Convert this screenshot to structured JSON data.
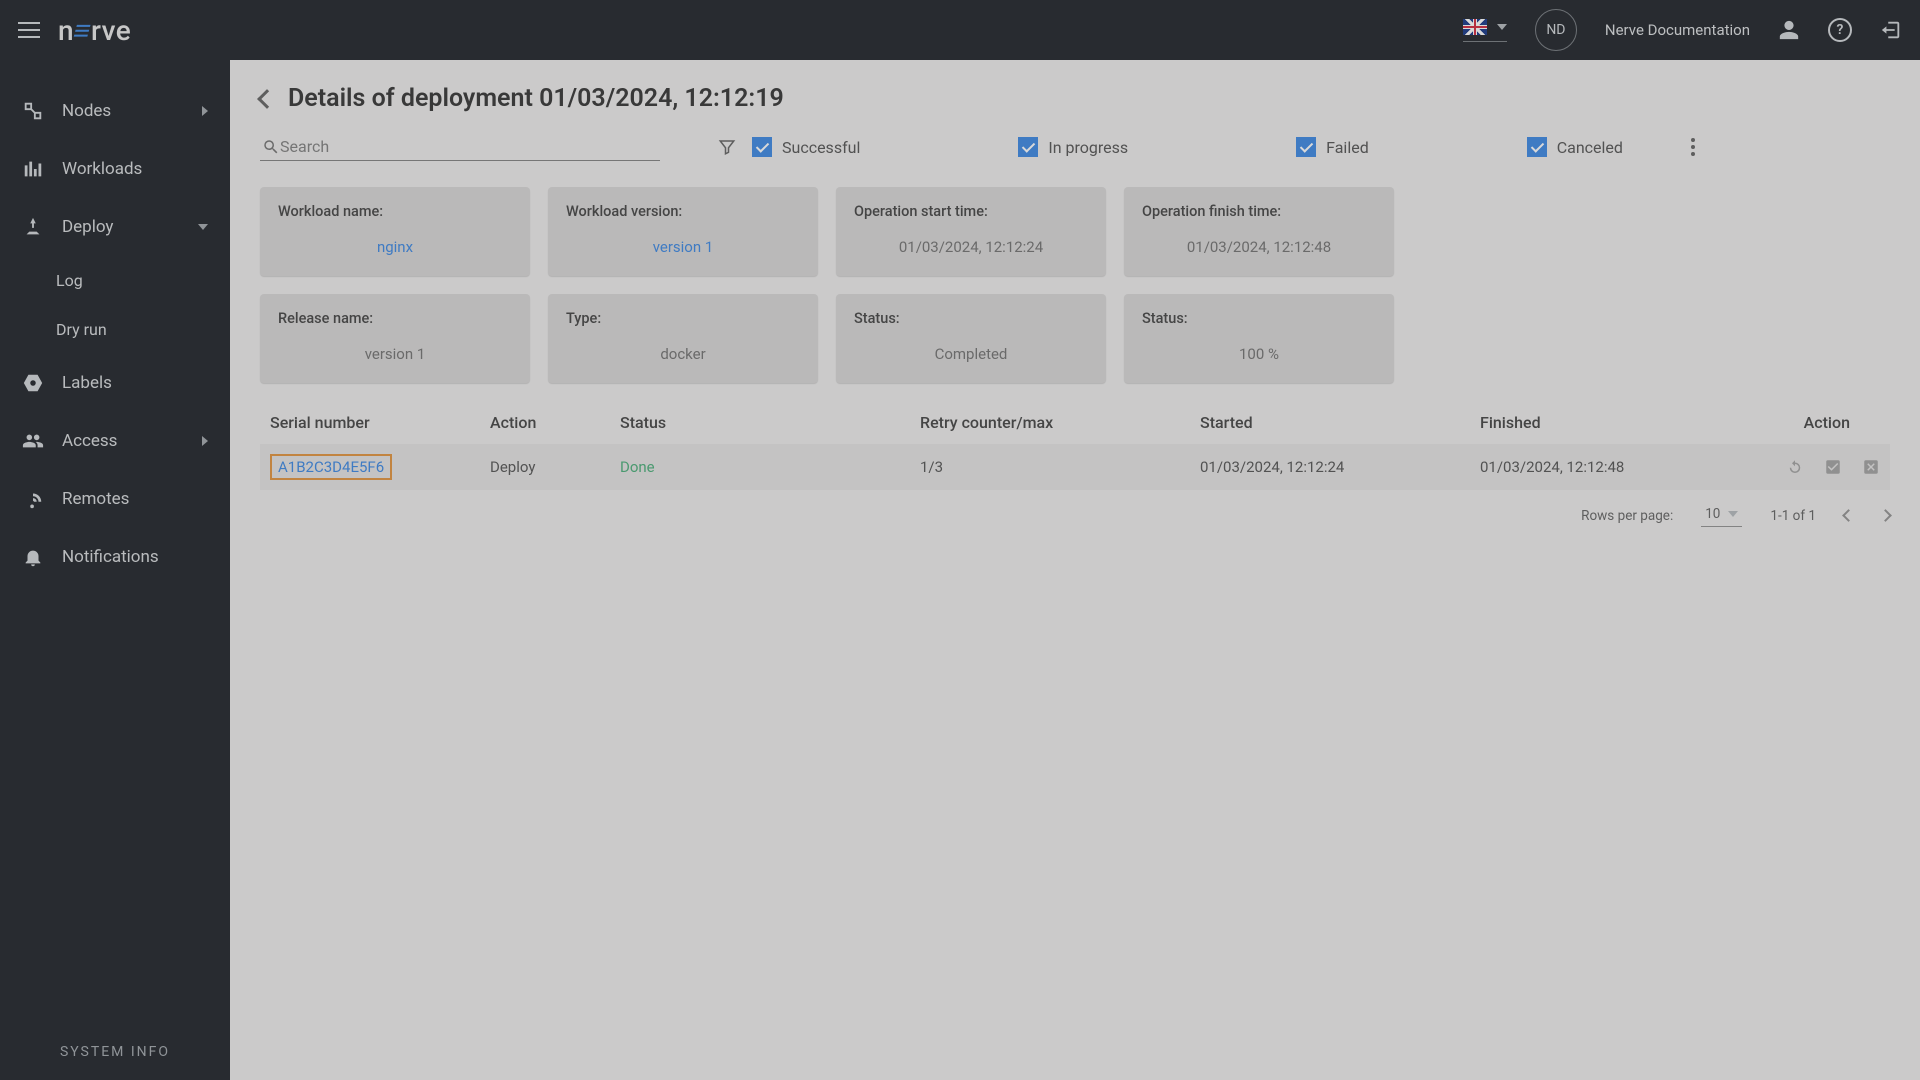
{
  "header": {
    "avatar_initials": "ND",
    "doc_link": "Nerve Documentation"
  },
  "sidebar": {
    "items": [
      {
        "label": "Nodes"
      },
      {
        "label": "Workloads"
      },
      {
        "label": "Deploy"
      },
      {
        "label": "Labels"
      },
      {
        "label": "Access"
      },
      {
        "label": "Remotes"
      },
      {
        "label": "Notifications"
      }
    ],
    "deploy_sub": [
      {
        "label": "Log"
      },
      {
        "label": "Dry run"
      }
    ],
    "sysinfo": "SYSTEM INFO"
  },
  "page": {
    "title": "Details of deployment 01/03/2024, 12:12:19",
    "search_placeholder": "Search",
    "filters": {
      "successful": "Successful",
      "in_progress": "In progress",
      "failed": "Failed",
      "canceled": "Canceled"
    }
  },
  "cards": [
    {
      "label": "Workload name:",
      "value": "nginx",
      "link": true
    },
    {
      "label": "Workload version:",
      "value": "version 1",
      "link": true
    },
    {
      "label": "Operation start time:",
      "value": "01/03/2024, 12:12:24",
      "link": false
    },
    {
      "label": "Operation finish time:",
      "value": "01/03/2024, 12:12:48",
      "link": false
    },
    {
      "label": "Release name:",
      "value": "version 1",
      "link": false
    },
    {
      "label": "Type:",
      "value": "docker",
      "link": false
    },
    {
      "label": "Status:",
      "value": "Completed",
      "link": false
    },
    {
      "label": "Status:",
      "value": "100 %",
      "link": false
    }
  ],
  "table": {
    "headers": {
      "serial": "Serial number",
      "action": "Action",
      "status": "Status",
      "retry": "Retry counter/max",
      "started": "Started",
      "finished": "Finished",
      "row_action": "Action"
    },
    "rows": [
      {
        "serial": "A1B2C3D4E5F6",
        "action": "Deploy",
        "status": "Done",
        "retry": "1/3",
        "started": "01/03/2024, 12:12:24",
        "finished": "01/03/2024, 12:12:48"
      }
    ]
  },
  "pagination": {
    "rpp_label": "Rows per page:",
    "rpp_value": "10",
    "range": "1-1 of 1"
  }
}
